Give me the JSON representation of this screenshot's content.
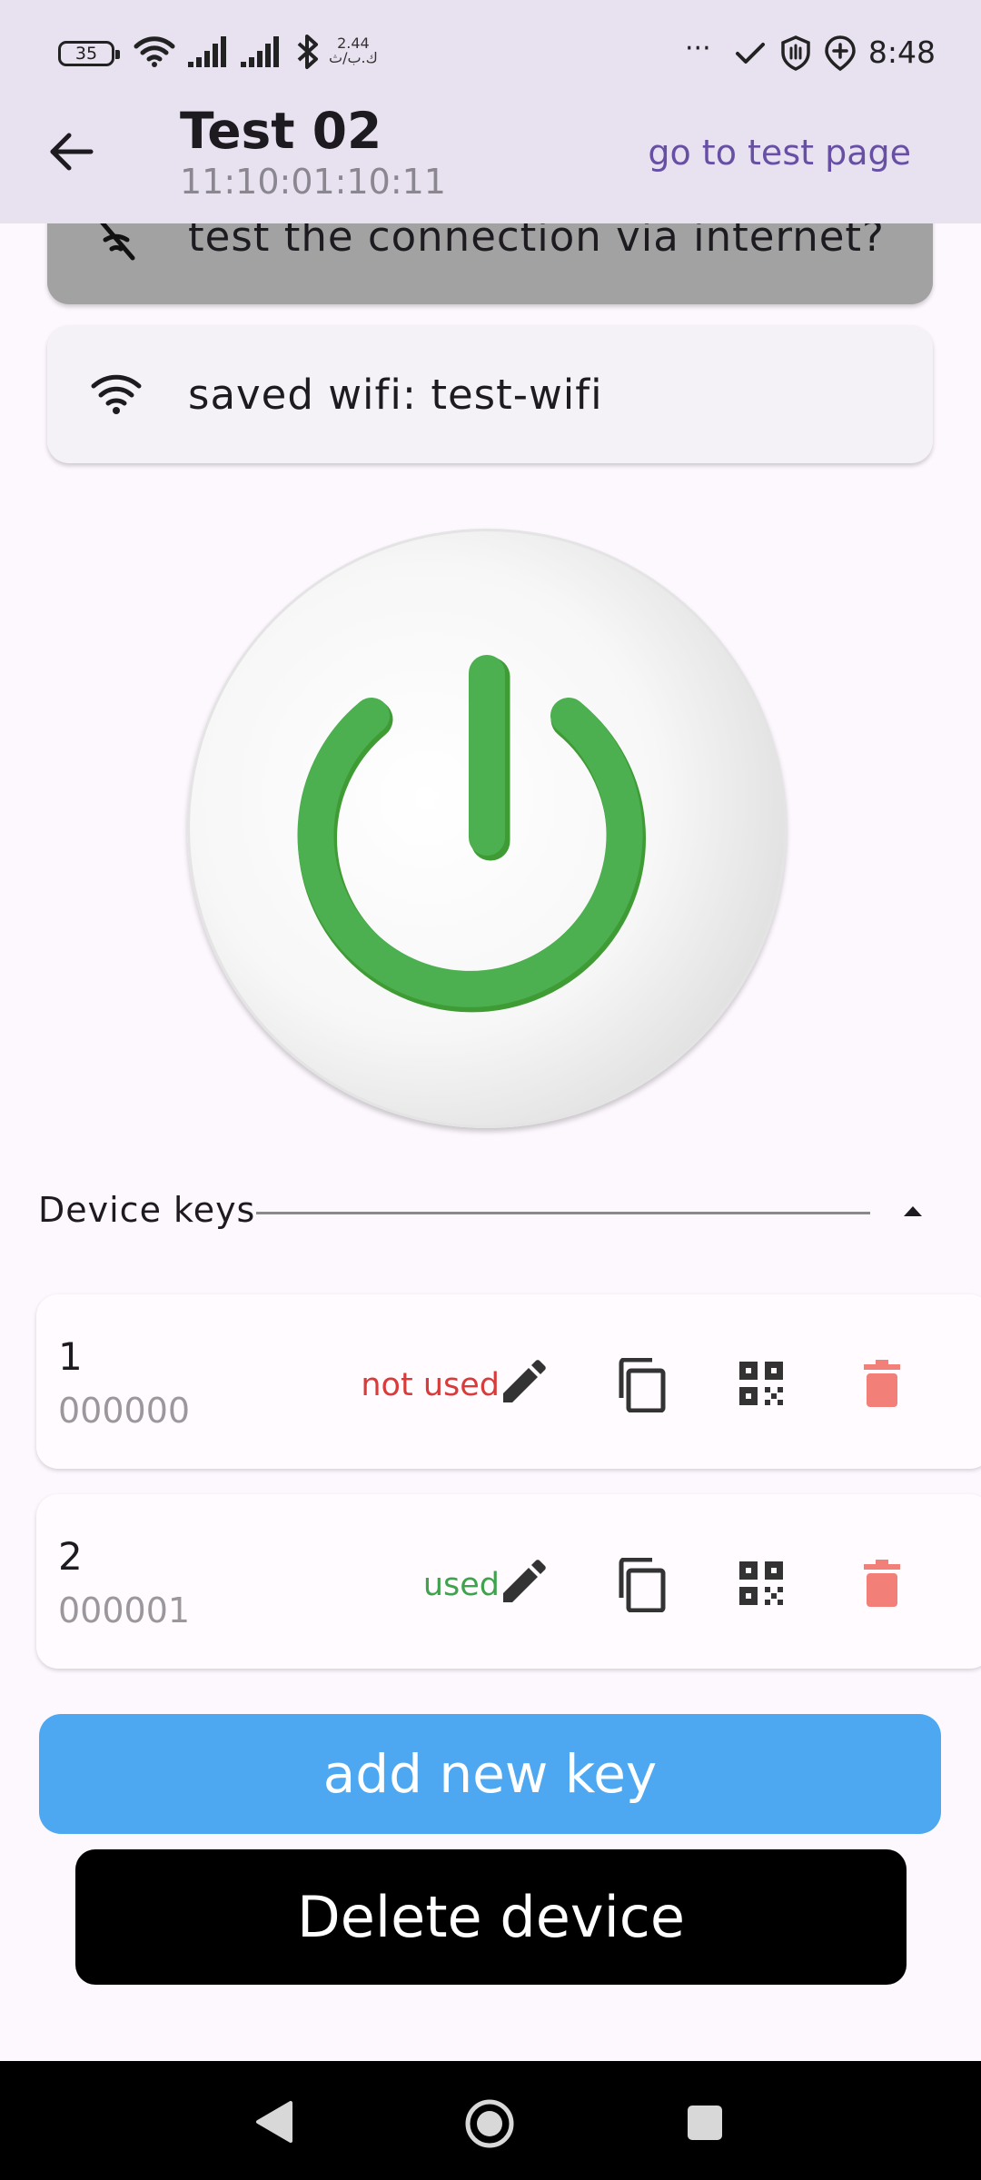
{
  "status_bar": {
    "battery_level": "35",
    "data_speed_value": "2.44",
    "data_speed_unit": "ك.ب/ث",
    "overflow": "···",
    "time": "8:48"
  },
  "app_bar": {
    "title": "Test 02",
    "subtitle": "11:10:01:10:11",
    "action_label": "go to test page"
  },
  "connection_cards": {
    "internet_label": "test the connection via internet?",
    "wifi_label": "saved wifi: test-wifi"
  },
  "power_button": {
    "state_color": "#4caf50"
  },
  "keys_section": {
    "label": "Device keys",
    "items": [
      {
        "number": "1",
        "code": "000000",
        "status": "not used",
        "status_color": "#d93a3a"
      },
      {
        "number": "2",
        "code": "000001",
        "status": "used",
        "status_color": "#3fa34d"
      }
    ]
  },
  "buttons": {
    "add_key_label": "add new key",
    "delete_device_label": "Delete device"
  },
  "colors": {
    "app_bar": "#e8e1f0",
    "accent": "#6750a4",
    "add_key": "#4da8f1",
    "delete_device": "#000000",
    "delete_icon": "#f27f78"
  }
}
